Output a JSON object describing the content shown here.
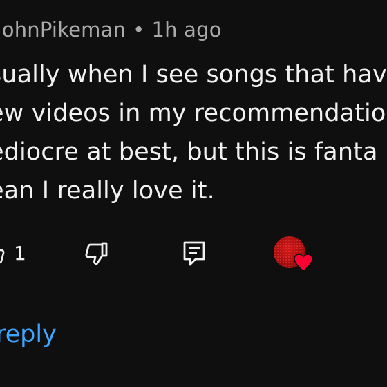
{
  "comment": {
    "author": "JohnPikeman",
    "separator": "•",
    "time_ago": "1h ago",
    "text_lines": [
      "sually when I see songs that hav",
      "ew videos in my recommendatio",
      "ediocre at best, but this is fanta",
      "ean I really love it."
    ]
  },
  "actions": {
    "like_count": "1",
    "like_icon": "thumb-up-icon",
    "dislike_icon": "thumb-down-icon",
    "reply_icon": "comment-reply-icon",
    "creator_heart_icon": "heart-icon",
    "heart_color": "#ff0033"
  },
  "replies": {
    "label": "reply"
  },
  "colors": {
    "background": "#0f0f0f",
    "text": "#f1f1f1",
    "meta": "#aaaaaa",
    "link": "#3ea6ff"
  }
}
